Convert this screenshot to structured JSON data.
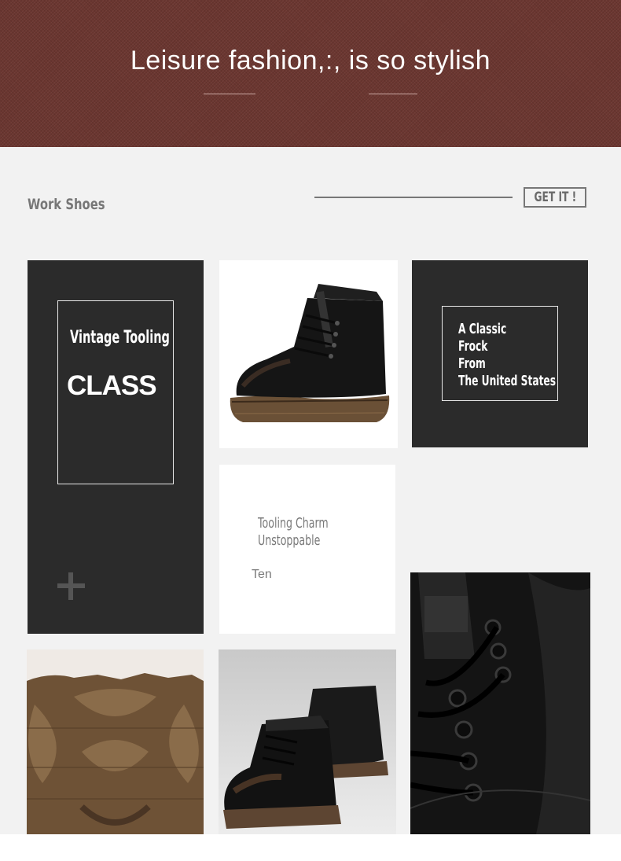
{
  "banner": {
    "title": "Leisure fashion,:, is so stylish",
    "background_color": "#6b3630"
  },
  "section": {
    "title": "Work Shoes",
    "cta_label": "GET IT !"
  },
  "tiles": {
    "vintage": {
      "line1": "Vintage Tooling",
      "line2": "CLASS",
      "icon": "plus-icon"
    },
    "classic": {
      "lines": [
        "A Classic",
        "Frock",
        "From",
        "The United States"
      ]
    },
    "charm": {
      "line1": "Tooling Charm",
      "line2": "Unstoppable",
      "line3": "Ten"
    }
  },
  "images": {
    "boot_side": "boot-side-photo",
    "sole": "sole-photo",
    "boot_pair": "boot-pair-photo",
    "boot_detail": "boot-detail-photo"
  },
  "colors": {
    "dark_tile": "#2b2b2b",
    "background": "#f2f2f2",
    "leather": "#141414",
    "sole": "#6a5036"
  }
}
